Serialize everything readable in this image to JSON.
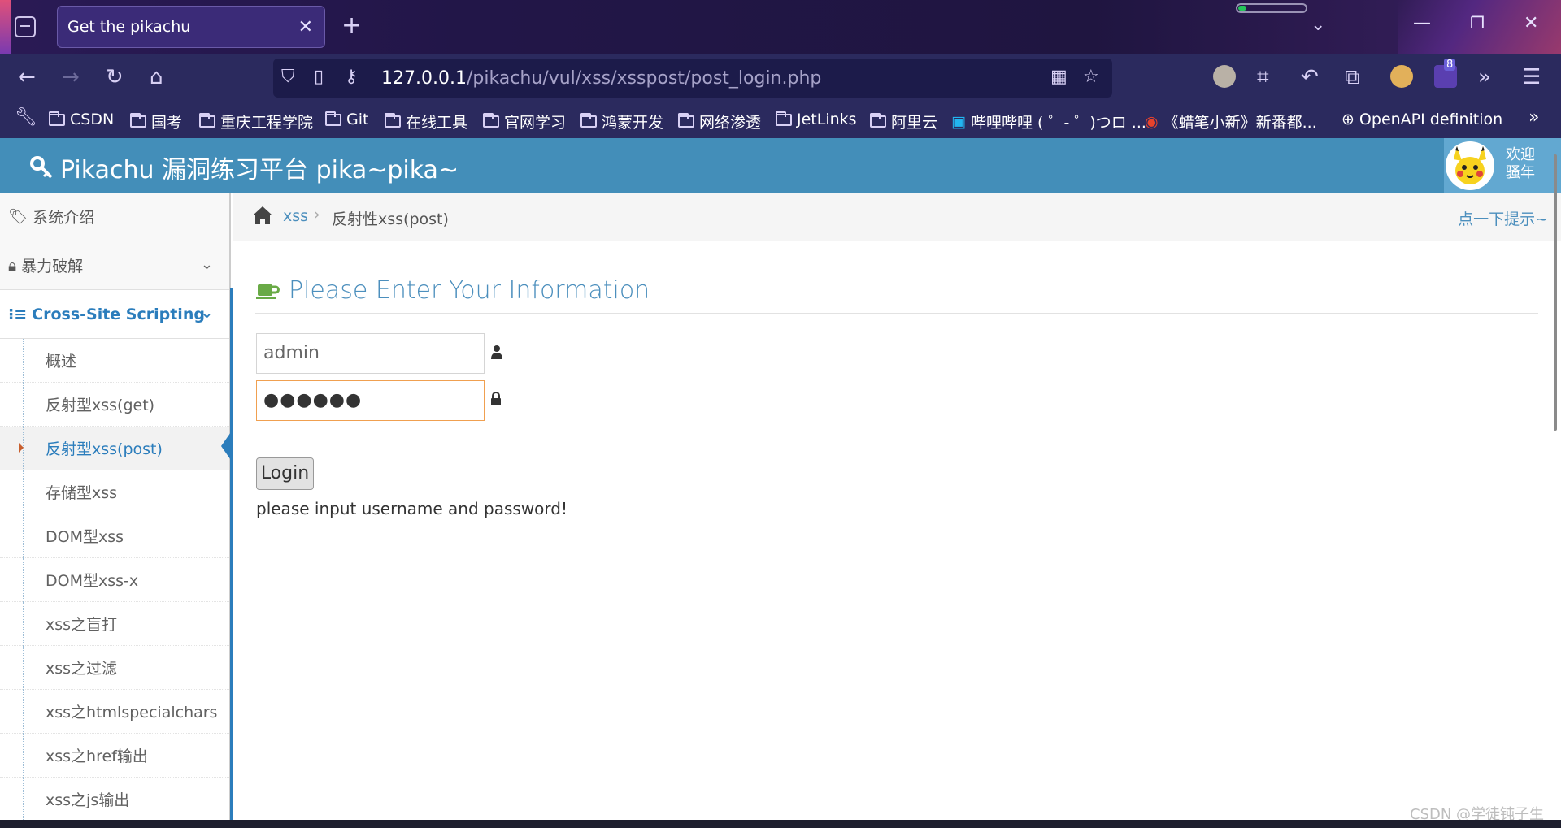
{
  "browser": {
    "tab_title": "Get the pikachu",
    "tab_close": "✕",
    "new_tab": "+",
    "url_host": "127.0.0.1",
    "url_path": "/pikachu/vul/xss/xsspost/post_login.php",
    "extension_badge": "8",
    "bookmarks": [
      "CSDN",
      "国考",
      "重庆工程学院",
      "Git",
      "在线工具",
      "官网学习",
      "鸿蒙开发",
      "网络渗透",
      "JetLinks",
      "阿里云",
      "哔哩哔哩 ( ゜- ゜)つロ ...",
      "《蜡笔小新》新番都...",
      "OpenAPI definition"
    ],
    "load_progress": 0.12
  },
  "app": {
    "title": "Pikachu 漏洞练习平台 pika~pika~",
    "welcome": "欢迎",
    "user": "骚年"
  },
  "sidebar": {
    "main": [
      {
        "label": "系统介绍"
      },
      {
        "label": "暴力破解"
      },
      {
        "label": "Cross-Site Scripting"
      }
    ],
    "sub": [
      "概述",
      "反射型xss(get)",
      "反射型xss(post)",
      "存储型xss",
      "DOM型xss",
      "DOM型xss-x",
      "xss之盲打",
      "xss之过滤",
      "xss之htmlspecialchars",
      "xss之href输出",
      "xss之js输出"
    ],
    "active_sub": "反射型xss(post)"
  },
  "breadcrumb": {
    "section": "xss",
    "separator": "›",
    "current": "反射性xss(post)",
    "hint": "点一下提示~"
  },
  "form": {
    "title": "Please Enter Your Information",
    "username": "admin",
    "password_masked": "●●●●●●",
    "login_label": "Login",
    "message": "please input username and password!"
  },
  "watermark": "CSDN @学徒钝子生",
  "colors": {
    "header": "#438eb9",
    "accent": "#2b7dbc",
    "link": "#4c8fbd",
    "browser_bg": "#2b2a5e"
  }
}
